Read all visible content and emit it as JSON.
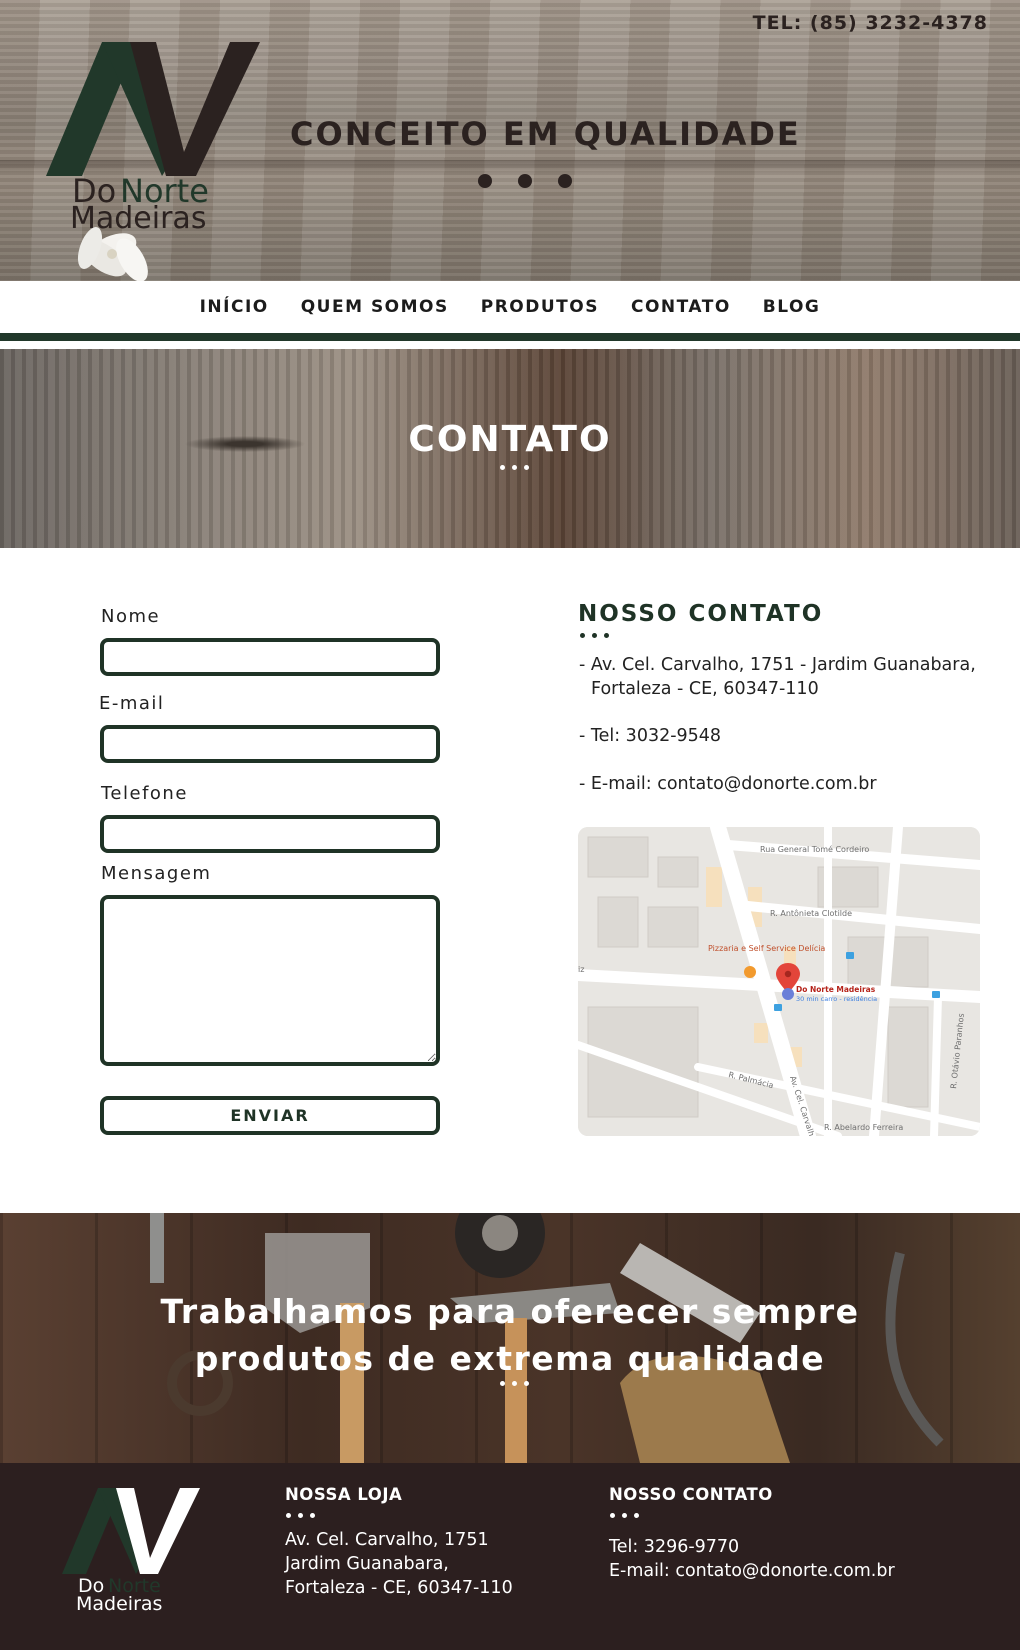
{
  "header": {
    "tel": "TEL: (85) 3232-4378",
    "slogan": "CONCEITO EM QUALIDADE",
    "logo_line1_a": "Do",
    "logo_line1_b": "Norte",
    "logo_line2": "Madeiras"
  },
  "nav": {
    "items": [
      "INÍCIO",
      "QUEM SOMOS",
      "PRODUTOS",
      "CONTATO",
      "BLOG"
    ]
  },
  "banner": {
    "title": "CONTATO"
  },
  "form": {
    "name_label": "Nome",
    "email_label": "E-mail",
    "phone_label": "Telefone",
    "message_label": "Mensagem",
    "submit_label": "ENVIAR"
  },
  "contact": {
    "title": "NOSSO CONTATO",
    "address_line1": "- Av. Cel. Carvalho, 1751 - Jardim Guanabara,",
    "address_line2": "Fortaleza - CE, 60347-110",
    "tel": "- Tel: 3032-9548",
    "email": "- E-mail: contato@donorte.com.br"
  },
  "map": {
    "streets": [
      "Rua General Tomé Cordeiro",
      "R. Antônieta Clotilde",
      "R. Palmácia",
      "Av. Cel. Carvalho",
      "R. Abelardo Ferreira",
      "R. Otávio Paranhos",
      "iz"
    ],
    "poi": "Pizzaria e Self Service Delícia",
    "pin_title": "Do Norte Madeiras",
    "pin_sub": "30 min carro - residência"
  },
  "tools": {
    "quote_line1": "Trabalhamos para oferecer sempre",
    "quote_line2": "produtos de extrema qualidade"
  },
  "footer": {
    "store_title": "NOSSA LOJA",
    "store_line1": "Av. Cel. Carvalho, 1751",
    "store_line2": "Jardim Guanabara,",
    "store_line3": "Fortaleza - CE, 60347-110",
    "contact_title": "NOSSO CONTATO",
    "contact_tel": "Tel: 3296-9770",
    "contact_email": "E-mail: contato@donorte.com.br"
  },
  "colors": {
    "brand_green": "#21382a",
    "dark_brown": "#2b2220",
    "footer_bg": "#2c1f1f",
    "logo_green_text": "#21382a"
  }
}
